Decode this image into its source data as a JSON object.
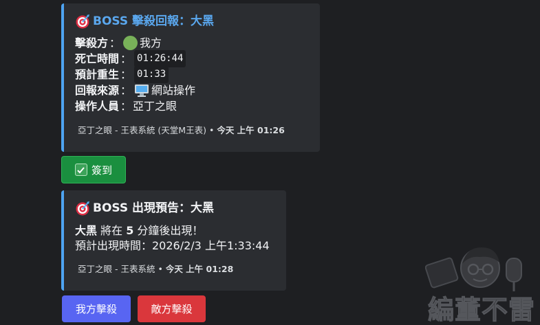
{
  "kill_report": {
    "title": "BOSS 擊殺回報：大黑",
    "rows": [
      {
        "label": "擊殺方",
        "value": "我方"
      },
      {
        "label": "死亡時間",
        "value": "01:26:44"
      },
      {
        "label": "預計重生",
        "value": "01:33"
      },
      {
        "label": "回報來源",
        "value": "網站操作"
      },
      {
        "label": "操作人員",
        "value": "亞丁之眼"
      }
    ],
    "separator": "：",
    "footer_source": "亞丁之眼 - 王表系統 (天堂M王表)",
    "footer_dot": "•",
    "footer_time": "今天 上午 01:26",
    "accent_color": "#4ea4f2"
  },
  "checkin_button": {
    "label": "簽到"
  },
  "spawn_notice": {
    "title": "BOSS 出現預告：大黑",
    "boss_name": "大黑",
    "line1_a": " 將在 ",
    "minutes": "5",
    "line1_b": " 分鐘後出現！",
    "line2": "預計出現時間：2026/2/3 上午1:33:44",
    "footer_source": "亞丁之眼 - 王表系統",
    "footer_dot": "•",
    "footer_time": "今天 上午 01:28"
  },
  "actions": {
    "ally_kill": "我方擊殺",
    "enemy_kill": "敵方擊殺"
  },
  "watermark": {
    "text": "編董不雷"
  },
  "icons": {
    "title_icon": "target-icon",
    "ally_icon": "green-circle-icon",
    "source_icon": "monitor-icon",
    "check_icon": "check-box-icon"
  }
}
